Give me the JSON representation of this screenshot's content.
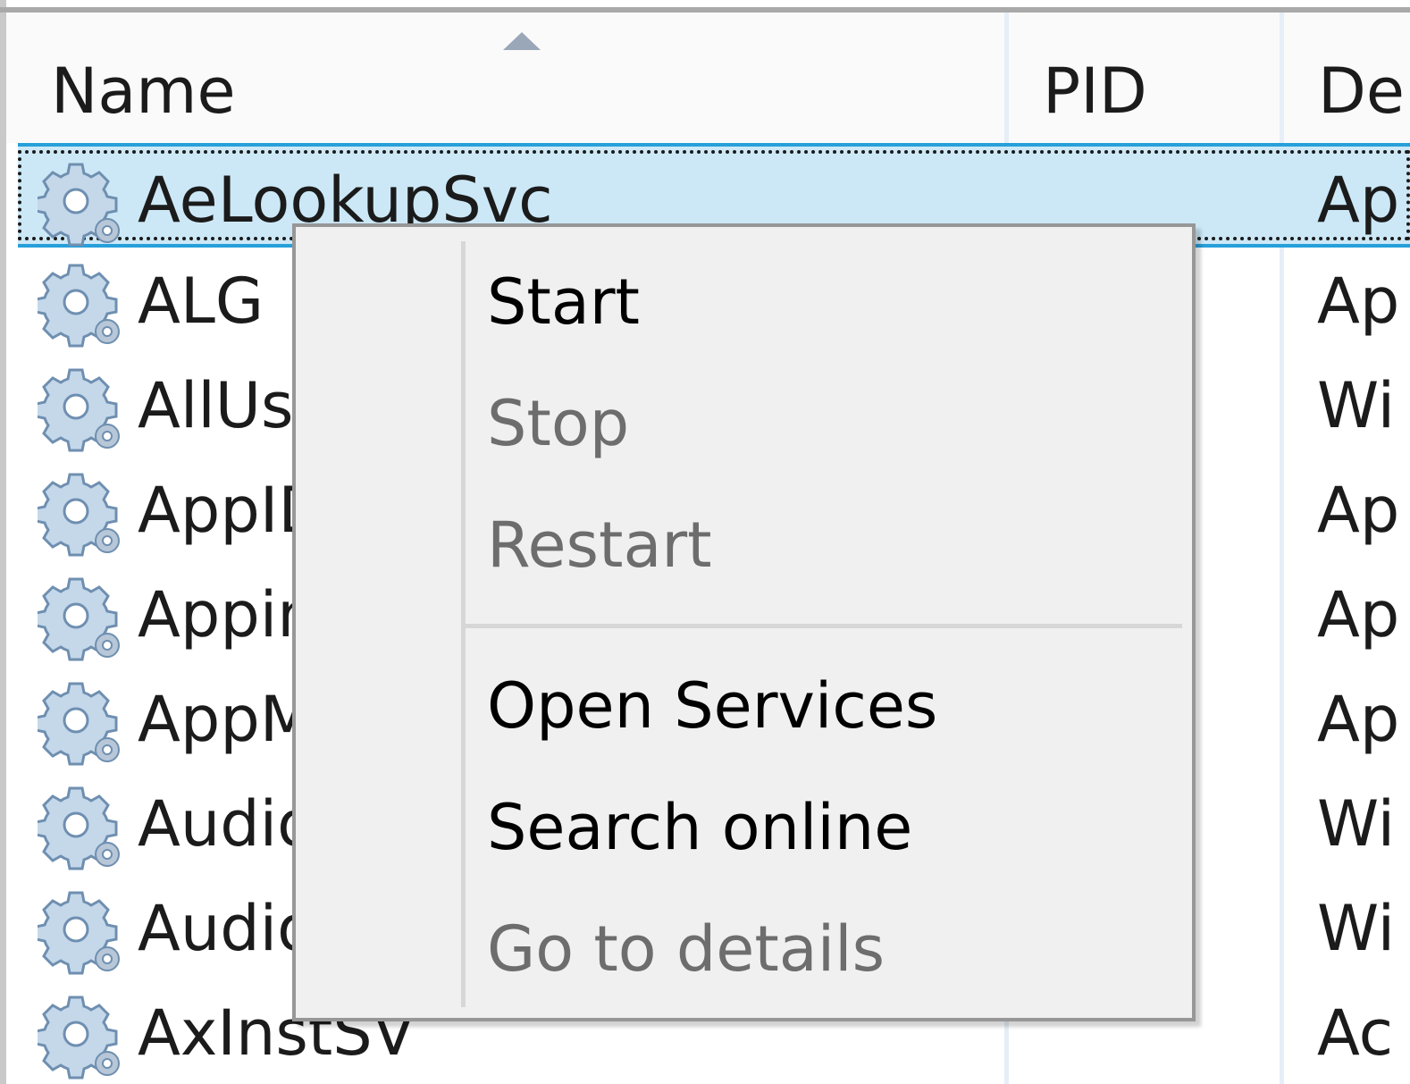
{
  "columns": {
    "name": "Name",
    "pid": "PID",
    "description": "De"
  },
  "sort": {
    "column": "Name",
    "direction": "ascending"
  },
  "rows": [
    {
      "name": "AeLookupSvc",
      "description": "Ap",
      "selected": true
    },
    {
      "name": "ALG",
      "description": "Ap"
    },
    {
      "name": "AllUs",
      "description": "Wi"
    },
    {
      "name": "AppID",
      "description": "Ap"
    },
    {
      "name": "Appin",
      "description": "Ap"
    },
    {
      "name": "AppM",
      "description": "Ap"
    },
    {
      "name": "Audio",
      "description": "Wi"
    },
    {
      "name": "Audio",
      "description": "Wi"
    },
    {
      "name": "AxInstSV",
      "description": "Ac"
    }
  ],
  "context_menu": {
    "items": [
      {
        "label": "Start",
        "enabled": true
      },
      {
        "label": "Stop",
        "enabled": false
      },
      {
        "label": "Restart",
        "enabled": false
      },
      {
        "label": "Open Services",
        "enabled": true
      },
      {
        "label": "Search online",
        "enabled": true
      },
      {
        "label": "Go to details",
        "enabled": false
      }
    ]
  },
  "colors": {
    "selection_background": "#cce8f7",
    "selection_border": "#26a0da",
    "menu_background": "#f0f0f0",
    "disabled_text": "#6d6d6d"
  },
  "icons": {
    "service_icon": "gear-icon",
    "sort_icon": "sort-ascending-icon"
  }
}
